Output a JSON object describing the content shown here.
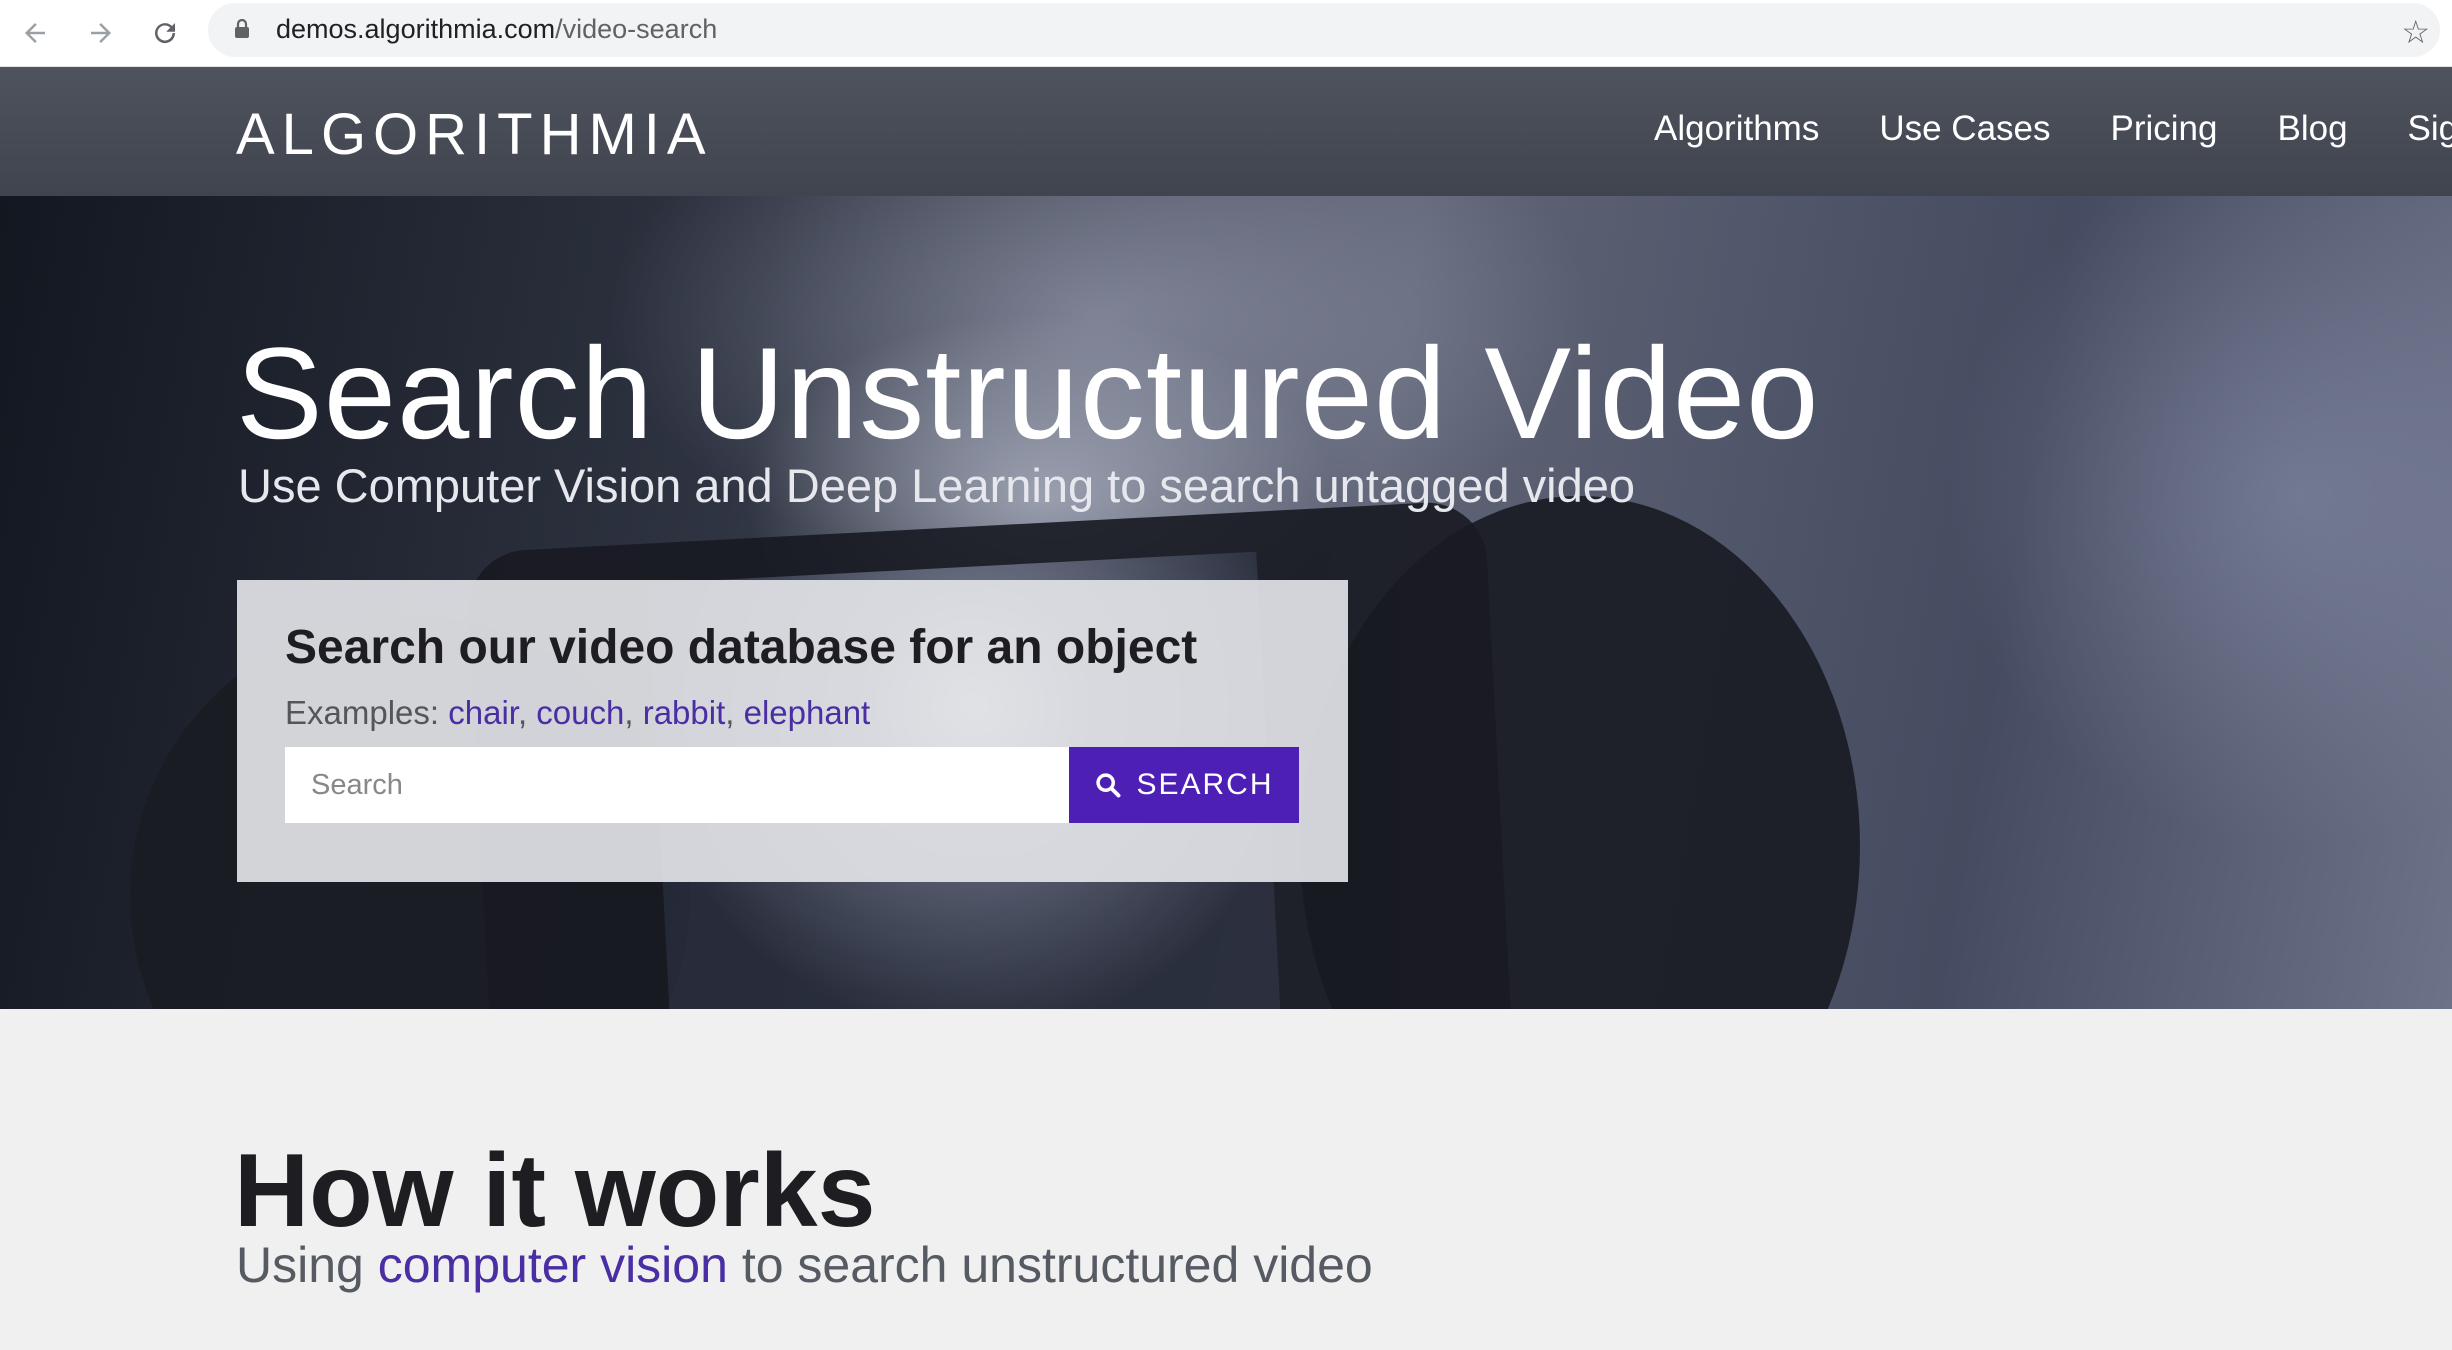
{
  "browser": {
    "url_domain": "demos.algorithmia.com",
    "url_path": "/video-search",
    "back_icon": "arrow-left-icon",
    "forward_icon": "arrow-right-icon",
    "reload_icon": "reload-icon",
    "bookmark_icon": "star-icon"
  },
  "header": {
    "logo": "ALGORITHMIA",
    "nav": [
      "Algorithms",
      "Use Cases",
      "Pricing",
      "Blog",
      "Sign"
    ]
  },
  "hero": {
    "title": "Search Unstructured Video",
    "subtitle": "Use Computer Vision and Deep Learning to search untagged video",
    "card": {
      "title": "Search our video database for an object",
      "examples_label": "Examples:",
      "examples": [
        "chair",
        "couch",
        "rabbit",
        "elephant"
      ],
      "search_placeholder": "Search",
      "search_button": "SEARCH"
    }
  },
  "how": {
    "title": "How it works",
    "subtitle_pre": "Using",
    "subtitle_link": "computer vision",
    "subtitle_post": "to search unstructured video"
  },
  "colors": {
    "accent": "#4d1fb5",
    "link": "#4a2ea3",
    "header_bg": "#4a4e59"
  }
}
